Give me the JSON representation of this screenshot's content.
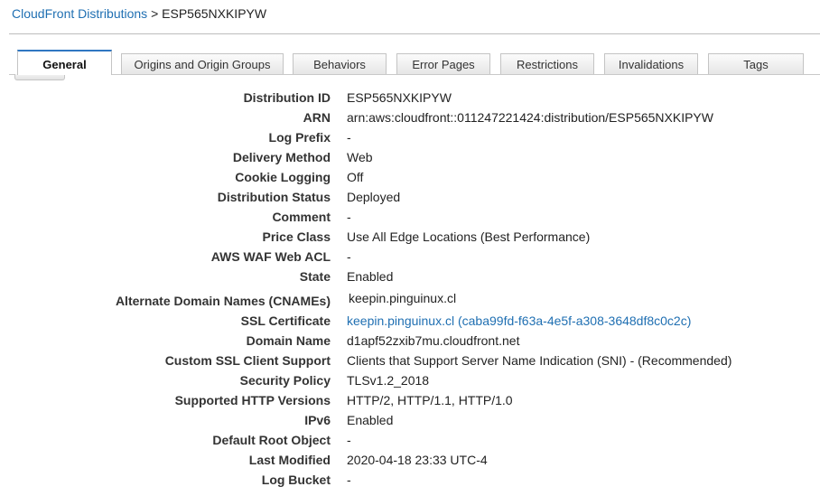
{
  "breadcrumb": {
    "parent": "CloudFront Distributions",
    "separator": ">",
    "current": "ESP565NXKIPYW"
  },
  "tabs": [
    {
      "label": "General",
      "active": true
    },
    {
      "label": "Origins and Origin Groups",
      "active": false
    },
    {
      "label": "Behaviors",
      "active": false
    },
    {
      "label": "Error Pages",
      "active": false
    },
    {
      "label": "Restrictions",
      "active": false
    },
    {
      "label": "Invalidations",
      "active": false
    },
    {
      "label": "Tags",
      "active": false
    }
  ],
  "details": [
    {
      "label": "Distribution ID",
      "value": "ESP565NXKIPYW"
    },
    {
      "label": "ARN",
      "value": "arn:aws:cloudfront::011247221424:distribution/ESP565NXKIPYW"
    },
    {
      "label": "Log Prefix",
      "value": "-"
    },
    {
      "label": "Delivery Method",
      "value": "Web"
    },
    {
      "label": "Cookie Logging",
      "value": "Off"
    },
    {
      "label": "Distribution Status",
      "value": "Deployed"
    },
    {
      "label": "Comment",
      "value": "-"
    },
    {
      "label": "Price Class",
      "value": "Use All Edge Locations (Best Performance)"
    },
    {
      "label": "AWS WAF Web ACL",
      "value": "-"
    },
    {
      "label": "State",
      "value": "Enabled"
    },
    {
      "label": "Alternate Domain Names (CNAMEs)",
      "value": "keepin.pinguinux.cl"
    },
    {
      "label": "SSL Certificate",
      "value": "keepin.pinguinux.cl (caba99fd-f63a-4e5f-a308-3648df8c0c2c)"
    },
    {
      "label": "Domain Name",
      "value": "d1apf52zxib7mu.cloudfront.net"
    },
    {
      "label": "Custom SSL Client Support",
      "value": "Clients that Support Server Name Indication (SNI) - (Recommended)"
    },
    {
      "label": "Security Policy",
      "value": "TLSv1.2_2018"
    },
    {
      "label": "Supported HTTP Versions",
      "value": "HTTP/2, HTTP/1.1, HTTP/1.0"
    },
    {
      "label": "IPv6",
      "value": "Enabled"
    },
    {
      "label": "Default Root Object",
      "value": "-"
    },
    {
      "label": "Last Modified",
      "value": "2020-04-18 23:33 UTC-4"
    },
    {
      "label": "Log Bucket",
      "value": "-"
    }
  ],
  "colors": {
    "link": "#1f6fb2",
    "active_tab_accent": "#2f77c2"
  }
}
